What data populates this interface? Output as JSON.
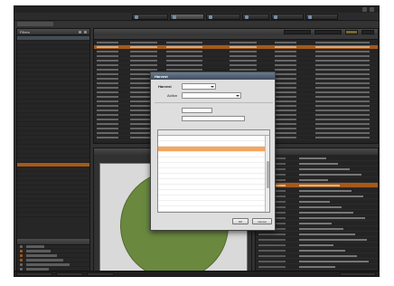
{
  "window": {
    "title": ""
  },
  "toolbar": {
    "buttons": [
      {
        "label": ""
      },
      {
        "label": ""
      },
      {
        "label": ""
      },
      {
        "label": ""
      },
      {
        "label": ""
      },
      {
        "label": ""
      }
    ]
  },
  "left_panel": {
    "title": "Filters",
    "sub_title": ""
  },
  "top_pane": {
    "title": ""
  },
  "dialog": {
    "title": "Harvest",
    "section_label": "Harvest",
    "select1": "",
    "action_label": "Action",
    "action_value": "",
    "field_a_label": "",
    "field_a_value": "",
    "field_b_label": "",
    "field_b_value": "",
    "grid_headers": [
      "",
      ""
    ],
    "rows": [
      {
        "k": "",
        "v": ""
      },
      {
        "k": "",
        "v": ""
      },
      {
        "k": "",
        "v": ""
      },
      {
        "k": "",
        "v": ""
      },
      {
        "k": "",
        "v": ""
      },
      {
        "k": "",
        "v": ""
      },
      {
        "k": "",
        "v": ""
      },
      {
        "k": "",
        "v": ""
      },
      {
        "k": "",
        "v": ""
      },
      {
        "k": "",
        "v": ""
      },
      {
        "k": "",
        "v": ""
      },
      {
        "k": "",
        "v": ""
      },
      {
        "k": "",
        "v": ""
      },
      {
        "k": "",
        "v": ""
      }
    ],
    "ok_label": "OK",
    "cancel_label": "Cancel"
  },
  "colors": {
    "highlight": "#c26a1e",
    "pie": "#7da24a",
    "dialog_title": "#4a5a6b"
  }
}
